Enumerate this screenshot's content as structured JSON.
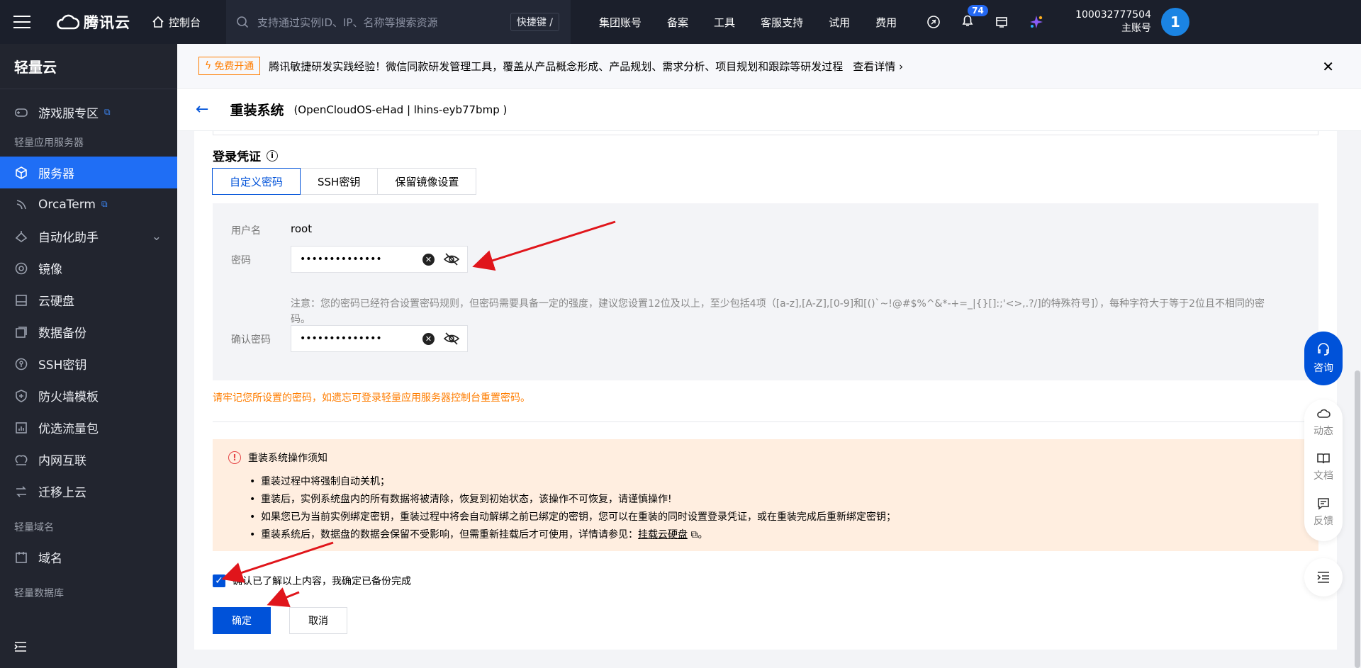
{
  "topbar": {
    "logo": "腾讯云",
    "console": "控制台",
    "search_placeholder": "支持通过实例ID、IP、名称等搜索资源",
    "shortcut": "快捷键 /",
    "nav": [
      "集团账号",
      "备案",
      "工具",
      "客服支持",
      "试用",
      "费用"
    ],
    "notify_count": "74",
    "account_id": "100032777504",
    "account_role": "主账号",
    "avatar": "1"
  },
  "sidebar": {
    "title": "轻量云",
    "items": [
      {
        "label": "游戏服专区",
        "icon": "gamepad-icon",
        "external": true
      },
      {
        "group": "轻量应用服务器"
      },
      {
        "label": "服务器",
        "icon": "cube-icon",
        "active": true
      },
      {
        "label": "OrcaTerm",
        "icon": "terminal-icon",
        "external": true
      },
      {
        "label": "自动化助手",
        "icon": "robot-icon",
        "expand": true
      },
      {
        "label": "镜像",
        "icon": "disc-icon"
      },
      {
        "label": "云硬盘",
        "icon": "disk-icon"
      },
      {
        "label": "数据备份",
        "icon": "backup-icon"
      },
      {
        "label": "SSH密钥",
        "icon": "key-icon"
      },
      {
        "label": "防火墙模板",
        "icon": "shield-icon"
      },
      {
        "label": "优选流量包",
        "icon": "chart-icon"
      },
      {
        "label": "内网互联",
        "icon": "link-icon"
      },
      {
        "label": "迁移上云",
        "icon": "migrate-icon"
      },
      {
        "group": "轻量域名"
      },
      {
        "label": "域名",
        "icon": "calendar-icon"
      },
      {
        "group": "轻量数据库"
      }
    ]
  },
  "banner": {
    "tag": "免费开通",
    "text": "腾讯敏捷研发实践经验！微信同款研发管理工具，覆盖从产品概念形成、产品规划、需求分析、项目规划和跟踪等研发过程",
    "link": "查看详情"
  },
  "page": {
    "title": "重装系统",
    "subtitle": "(OpenCloudOS-eHad | lhins-eyb77bmp )"
  },
  "credentials": {
    "section_title": "登录凭证",
    "tabs": [
      "自定义密码",
      "SSH密钥",
      "保留镜像设置"
    ],
    "username_label": "用户名",
    "username_value": "root",
    "password_label": "密码",
    "password_value": "••••••••••••••",
    "note": "注意：您的密码已经符合设置密码规则，但密码需要具备一定的强度，建议您设置12位及以上，至少包括4项（[a-z],[A-Z],[0-9]和[()`~!@#$%^&*-+=_|{}[]:;'<>,.?/]的特殊符号]），每种字符大于等于2位且不相同的密码。",
    "confirm_label": "确认密码",
    "confirm_value": "••••••••••••••"
  },
  "reminder": "请牢记您所设置的密码，如遗忘可登录轻量应用服务器控制台重置密码。",
  "notice": {
    "title": "重装系统操作须知",
    "items": [
      "重装过程中将强制自动关机；",
      "重装后，实例系统盘内的所有数据将被清除，恢复到初始状态，该操作不可恢复，请谨慎操作!",
      "如果您已为当前实例绑定密钥，重装过程中将会自动解绑之前已绑定的密钥，您可以在重装的同时设置登录凭证，或在重装完成后重新绑定密钥；"
    ],
    "last_item_prefix": "重装系统后，数据盘的数据会保留不受影响，但需重新挂载后才可使用，详情请参见：",
    "last_item_link": "挂载云硬盘",
    "last_item_suffix": "。"
  },
  "confirm_checkbox": "确认已了解以上内容，我确定已备份完成",
  "buttons": {
    "ok": "确定",
    "cancel": "取消"
  },
  "float": {
    "consult": "咨询",
    "items": [
      "动态",
      "文档",
      "反馈"
    ]
  },
  "colors": {
    "primary": "#0052d9",
    "sidebar_active": "#1f6ef5",
    "warning": "#ff7d00",
    "arrow": "#e0151b"
  }
}
